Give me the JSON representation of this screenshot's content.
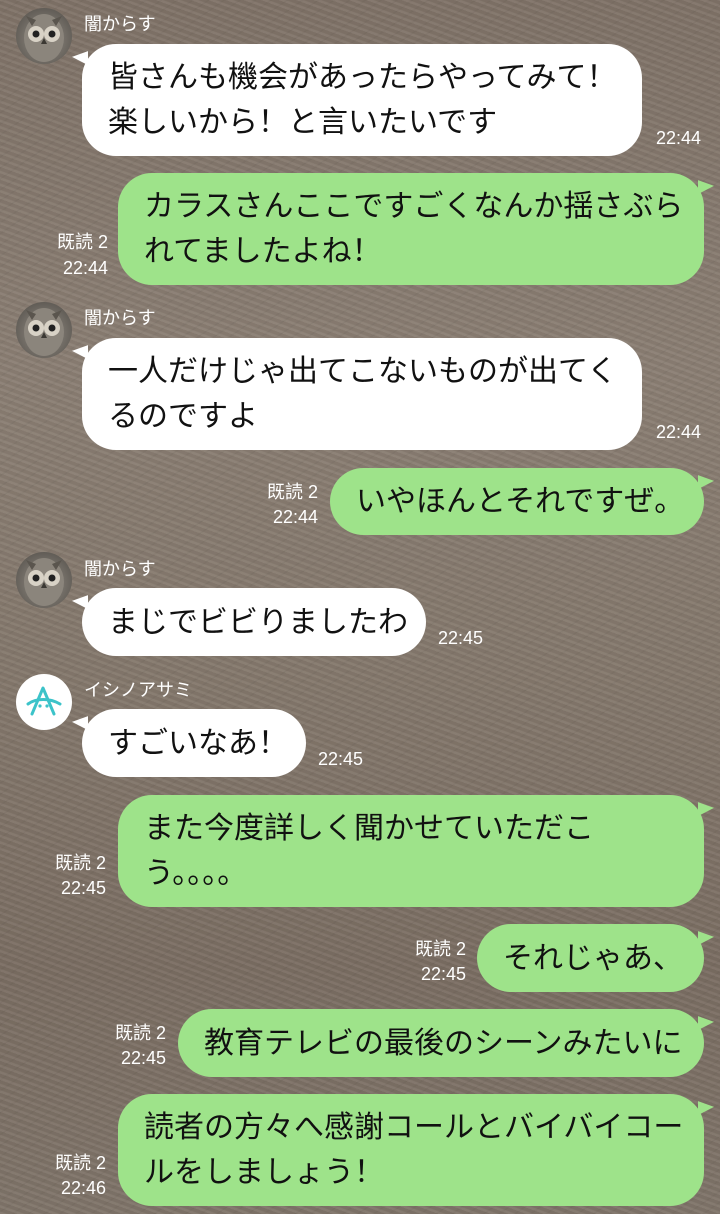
{
  "messages": [
    {
      "sender": "闇からす",
      "type": "in",
      "text": "皆さんも機会があったらやってみて！\n楽しいから！と言いたいです",
      "time": "22:44"
    },
    {
      "type": "out",
      "read": "既読 2",
      "text": "カラスさんここですごくなんか揺さぶら\nれてましたよね！",
      "time": "22:44"
    },
    {
      "sender": "闇からす",
      "type": "in",
      "text": "一人だけじゃ出てこないものが出てく\nるのですよ",
      "time": "22:44"
    },
    {
      "type": "out",
      "read": "既読 2",
      "text": "いやほんとそれですぜ。",
      "time": "22:44"
    },
    {
      "sender": "闇からす",
      "type": "in",
      "text": "まじでビビりましたわ",
      "time": "22:45"
    },
    {
      "sender": "イシノアサミ",
      "type": "in",
      "text": "すごいなあ！",
      "time": "22:45"
    },
    {
      "type": "out",
      "read": "既読 2",
      "text": "また今度詳しく聞かせていただこ\nう。。。。",
      "time": "22:45"
    },
    {
      "type": "out",
      "read": "既読 2",
      "text": "それじゃあ、",
      "time": "22:45"
    },
    {
      "type": "out",
      "read": "既読 2",
      "text": "教育テレビの最後のシーンみたいに",
      "time": "22:45"
    },
    {
      "type": "out",
      "read": "既読 2",
      "text": "読者の方々へ感謝コールとバイバイコー\nルをしましょう！",
      "time": "22:46"
    }
  ]
}
